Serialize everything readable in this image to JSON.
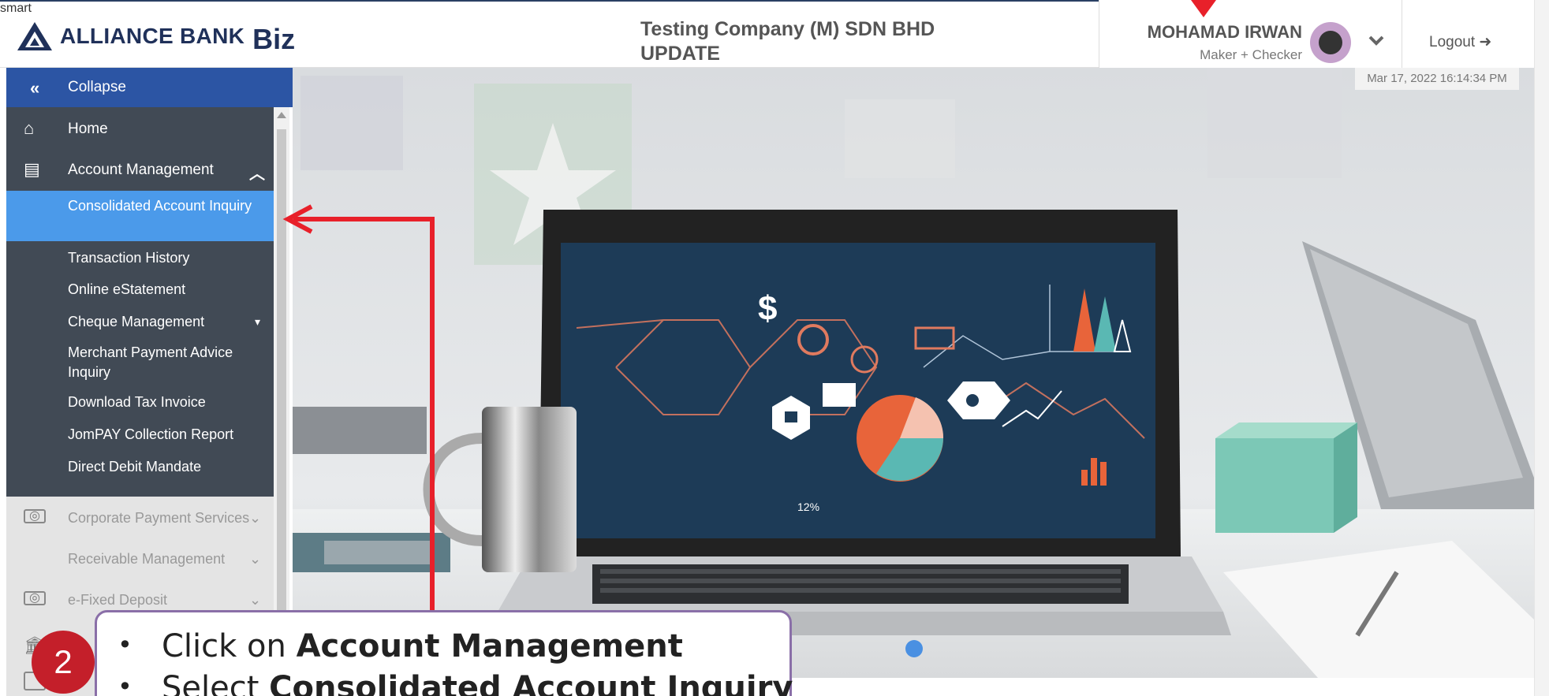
{
  "header": {
    "logo_text": "ALLIANCE BANK",
    "logo_biz": "Biz",
    "logo_smart": "smart",
    "company_line1": "Testing Company (M) SDN BHD",
    "company_line2": "UPDATE",
    "user_name": "MOHAMAD IRWAN",
    "user_role": "Maker + Checker",
    "logout_label": "Logout",
    "datetime": "Mar 17, 2022 16:14:34 PM"
  },
  "sidebar": {
    "collapse_label": "Collapse",
    "home_label": "Home",
    "account_management_label": "Account Management",
    "submenu": [
      "Consolidated Account Inquiry",
      "Transaction History",
      "Online eStatement",
      "Cheque Management",
      "Merchant Payment Advice Inquiry",
      "Download Tax Invoice",
      "JomPAY Collection Report",
      "Direct Debit Mandate"
    ],
    "lower_items": [
      "Corporate Payment Services",
      "Receivable Management",
      "e-Fixed Deposit"
    ]
  },
  "annotation": {
    "step_number": "2",
    "line1_prefix": "Click on ",
    "line1_bold": "Account Management",
    "line2_prefix": "Select ",
    "line2_bold": "Consolidated Account Inquiry"
  },
  "colors": {
    "header_navy": "#20315a",
    "sidebar_dark": "#414a55",
    "collapse_blue": "#2c55a4",
    "active_blue": "#4b9aea",
    "arrow_red": "#e8202a",
    "avatar_purple": "#c5a1cc"
  },
  "hero": {
    "image_label_percent": "12%"
  }
}
